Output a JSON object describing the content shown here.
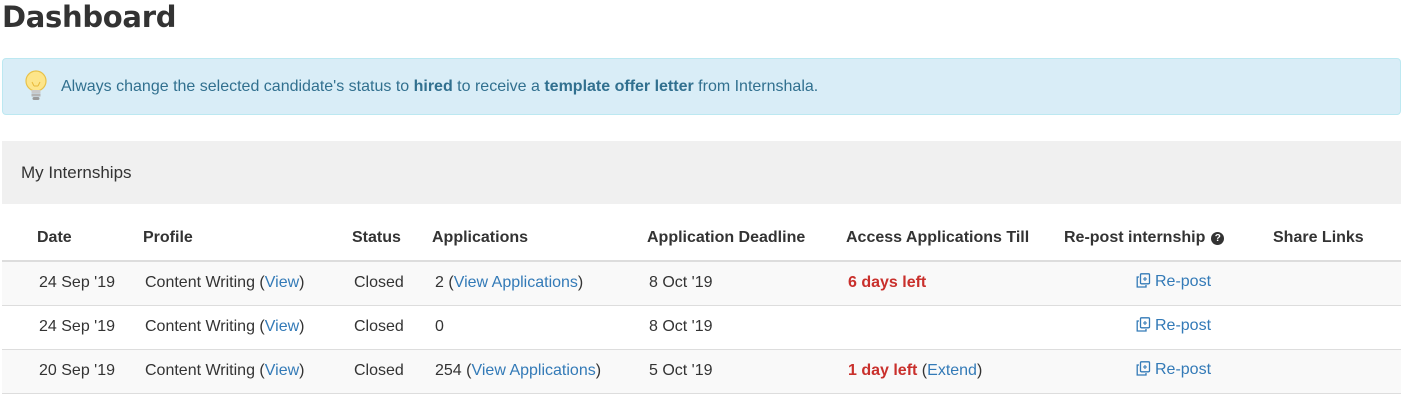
{
  "page": {
    "title": "Dashboard"
  },
  "alert": {
    "text_1": "Always change the selected candidate's status to ",
    "bold_1": "hired",
    "text_2": " to receive a ",
    "bold_2": "template offer letter",
    "text_3": " from Internshala.",
    "icon": "lightbulb-icon"
  },
  "panel": {
    "title": "My Internships"
  },
  "table": {
    "headers": {
      "date": "Date",
      "profile": "Profile",
      "status": "Status",
      "applications": "Applications",
      "deadline": "Application Deadline",
      "access": "Access Applications Till",
      "repost": "Re-post internship",
      "share": "Share Links"
    },
    "view_label": "View",
    "view_applications_label": "View Applications",
    "repost_label": "Re-post",
    "extend_label": "Extend",
    "rows": [
      {
        "date": "24 Sep '19",
        "profile": "Content Writing",
        "status": "Closed",
        "applications_count": "2",
        "deadline": "8 Oct '19",
        "access": "6 days left"
      },
      {
        "date": "24 Sep '19",
        "profile": "Content Writing",
        "status": "Closed",
        "applications_count": "0",
        "deadline": "8 Oct '19",
        "access": ""
      },
      {
        "date": "20 Sep '19",
        "profile": "Content Writing",
        "status": "Closed",
        "applications_count": "254",
        "deadline": "5 Oct '19",
        "access": "1 day left"
      }
    ]
  },
  "colors": {
    "link": "#337ab7",
    "alert_bg": "#d9edf7",
    "alert_text": "#31708f",
    "danger": "#c9302c"
  }
}
